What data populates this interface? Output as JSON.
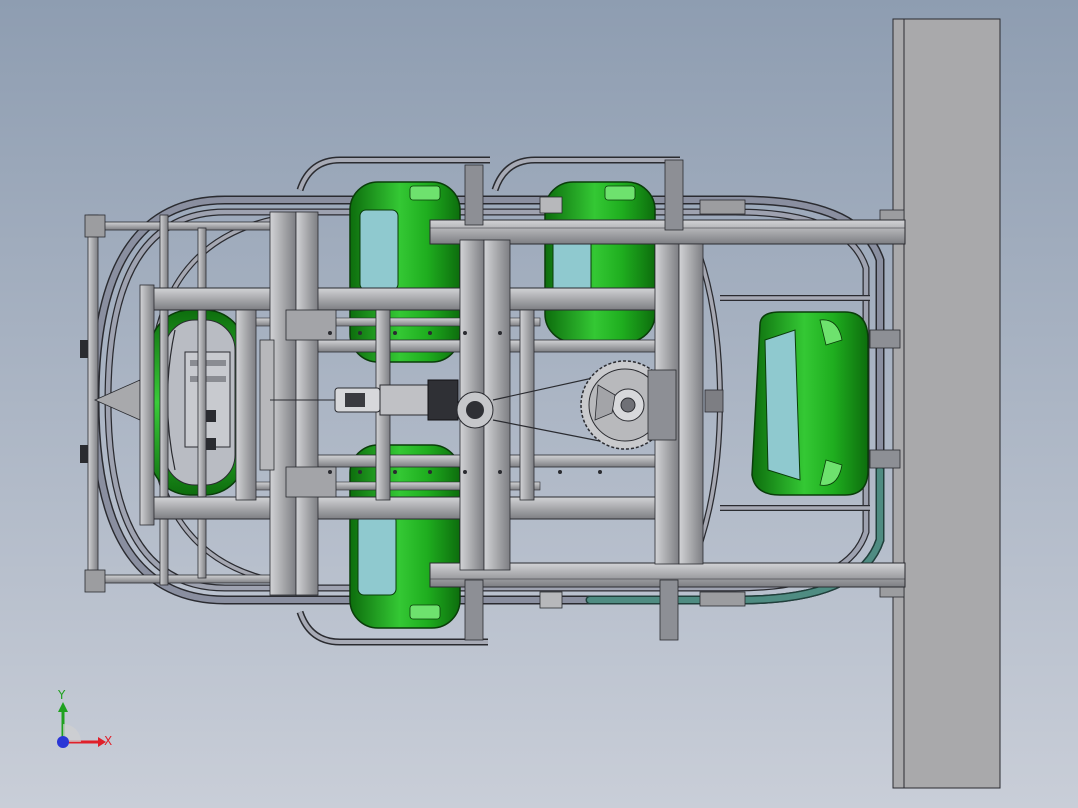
{
  "viewport": {
    "background_top": "#8e9db1",
    "background_bottom": "#c9ced8"
  },
  "colors": {
    "steel": "#a8a9ac",
    "steel_dark": "#5f6168",
    "steel_light": "#c4c5c8",
    "edge": "#2a2b30",
    "car_green": "#1fae1f",
    "car_green_dark": "#0d6d0d",
    "car_green_light": "#6ee26e",
    "glass": "#8fc9cf",
    "track": "#8a8fa0",
    "track_teal": "#4f8c82",
    "wall": "#a9a9ab"
  },
  "triad": {
    "x_label": "X",
    "y_label": "Y",
    "x_color": "#e0202a",
    "y_color": "#1fa11f",
    "z_color": "#2a36d6"
  },
  "components": [
    "support-wall",
    "upper-boom",
    "lower-boom",
    "rotating-frame",
    "oval-track",
    "passenger-car-top-left",
    "passenger-car-top-right",
    "passenger-car-bottom-left",
    "passenger-car-left",
    "passenger-car-right",
    "drive-motor",
    "sprocket-gear",
    "coordinate-triad"
  ]
}
